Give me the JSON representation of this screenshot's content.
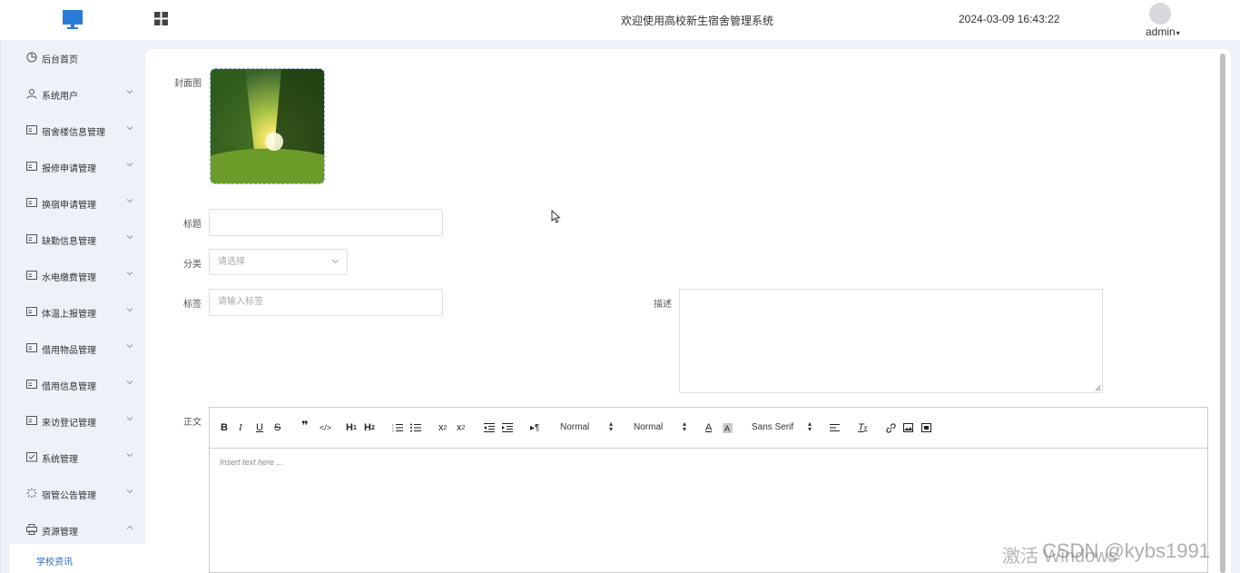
{
  "header": {
    "title": "欢迎使用高校新生宿舍管理系统",
    "datetime": "2024-03-09 16:43:22",
    "user": "admin"
  },
  "sidebar": {
    "items": [
      {
        "label": "后台首页",
        "icon": "clock-icon",
        "expandable": false
      },
      {
        "label": "系统用户",
        "icon": "user-icon",
        "expandable": true
      },
      {
        "label": "宿舍楼信息管理",
        "icon": "card-icon",
        "expandable": true
      },
      {
        "label": "报修申请管理",
        "icon": "card-icon",
        "expandable": true
      },
      {
        "label": "换宿申请管理",
        "icon": "card-icon",
        "expandable": true
      },
      {
        "label": "缺勤信息管理",
        "icon": "card-icon",
        "expandable": true
      },
      {
        "label": "水电缴费管理",
        "icon": "card-icon",
        "expandable": true
      },
      {
        "label": "体温上报管理",
        "icon": "card-icon",
        "expandable": true
      },
      {
        "label": "借用物品管理",
        "icon": "card-icon",
        "expandable": true
      },
      {
        "label": "借用信息管理",
        "icon": "card-icon",
        "expandable": true
      },
      {
        "label": "来访登记管理",
        "icon": "card-icon",
        "expandable": true
      },
      {
        "label": "系统管理",
        "icon": "folder-check-icon",
        "expandable": true
      },
      {
        "label": "宿管公告管理",
        "icon": "loading-icon",
        "expandable": true
      },
      {
        "label": "资源管理",
        "icon": "printer-icon",
        "expandable": true,
        "expanded": true
      }
    ],
    "active_subitem": "学校资讯"
  },
  "form": {
    "cover_label": "封面图",
    "title_label": "标题",
    "title_value": "",
    "category_label": "分类",
    "category_placeholder": "请选择",
    "tags_label": "标签",
    "tags_placeholder": "请输入标签",
    "description_label": "描述",
    "content_label": "正文"
  },
  "editor": {
    "size_select": "Normal",
    "header_select": "Normal",
    "font_select": "Sans Serif",
    "placeholder": "Insert text here ..."
  },
  "watermark": {
    "activate": "激活 Windows",
    "csdn": "CSDN @kybs1991"
  }
}
